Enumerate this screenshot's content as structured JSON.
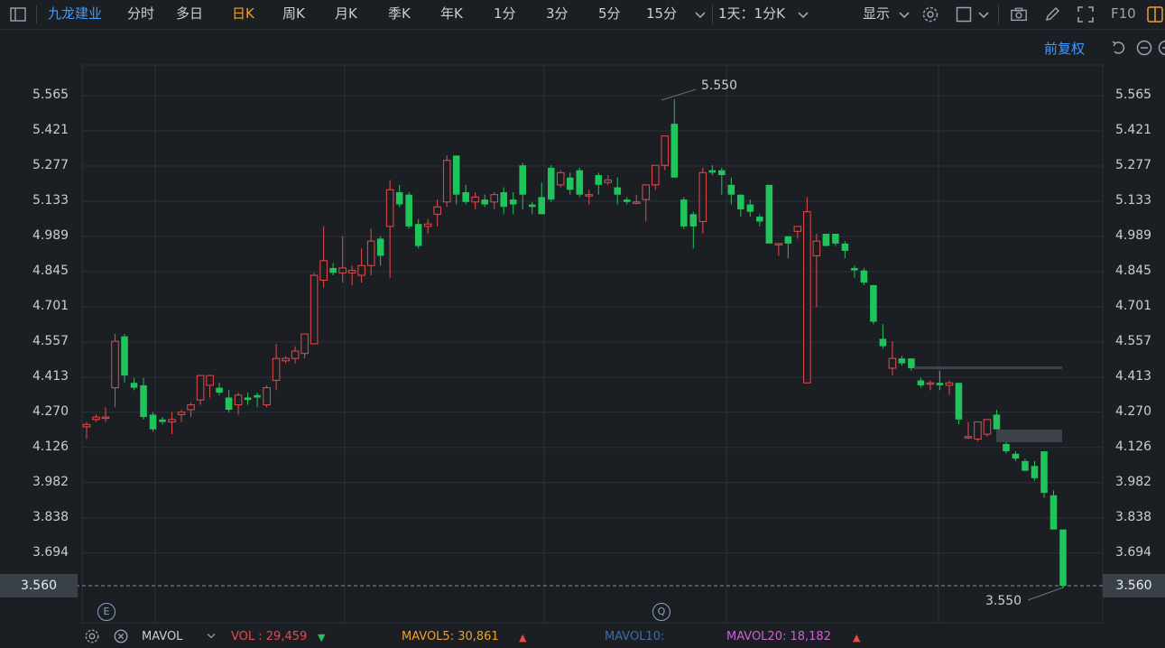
{
  "toolbar": {
    "stock_name": "九龙建业",
    "periods": [
      "分时",
      "多日",
      "日K",
      "周K",
      "月K",
      "季K",
      "年K",
      "1分",
      "3分",
      "5分",
      "15分"
    ],
    "active_period": "日K",
    "range_selector": "1天：1分K",
    "display_label": "显示",
    "f10_label": "F10"
  },
  "subbar": {
    "adjust_label": "前复权"
  },
  "chart": {
    "y_ticks": [
      "5.565",
      "5.421",
      "5.277",
      "5.133",
      "4.989",
      "4.845",
      "4.701",
      "4.557",
      "4.413",
      "4.270",
      "4.126",
      "3.982",
      "3.838",
      "3.694"
    ],
    "current_price_label": "3.560",
    "high_annotation": "5.550",
    "low_annotation": "3.550",
    "up_color": "#e84a4a",
    "down_color": "#1fc45a"
  },
  "chart_data": {
    "type": "candlestick",
    "ylim": [
      3.56,
      5.565
    ],
    "up_color": "#e84a4a",
    "down_color": "#1fc45a",
    "candles": [
      {
        "o": 4.21,
        "h": 4.23,
        "l": 4.16,
        "c": 4.22
      },
      {
        "o": 4.24,
        "h": 4.26,
        "l": 4.23,
        "c": 4.25
      },
      {
        "o": 4.25,
        "h": 4.29,
        "l": 4.23,
        "c": 4.25
      },
      {
        "o": 4.37,
        "h": 4.59,
        "l": 4.29,
        "c": 4.56
      },
      {
        "o": 4.58,
        "h": 4.59,
        "l": 4.39,
        "c": 4.42
      },
      {
        "o": 4.39,
        "h": 4.41,
        "l": 4.36,
        "c": 4.37
      },
      {
        "o": 4.38,
        "h": 4.41,
        "l": 4.24,
        "c": 4.25
      },
      {
        "o": 4.26,
        "h": 4.27,
        "l": 4.19,
        "c": 4.2
      },
      {
        "o": 4.24,
        "h": 4.25,
        "l": 4.22,
        "c": 4.23
      },
      {
        "o": 4.23,
        "h": 4.27,
        "l": 4.18,
        "c": 4.24
      },
      {
        "o": 4.26,
        "h": 4.28,
        "l": 4.23,
        "c": 4.27
      },
      {
        "o": 4.28,
        "h": 4.31,
        "l": 4.25,
        "c": 4.3
      },
      {
        "o": 4.32,
        "h": 4.42,
        "l": 4.3,
        "c": 4.42
      },
      {
        "o": 4.38,
        "h": 4.42,
        "l": 4.33,
        "c": 4.42
      },
      {
        "o": 4.37,
        "h": 4.39,
        "l": 4.34,
        "c": 4.35
      },
      {
        "o": 4.33,
        "h": 4.36,
        "l": 4.27,
        "c": 4.28
      },
      {
        "o": 4.3,
        "h": 4.35,
        "l": 4.26,
        "c": 4.34
      },
      {
        "o": 4.33,
        "h": 4.35,
        "l": 4.3,
        "c": 4.32
      },
      {
        "o": 4.34,
        "h": 4.35,
        "l": 4.29,
        "c": 4.33
      },
      {
        "o": 4.3,
        "h": 4.38,
        "l": 4.29,
        "c": 4.37
      },
      {
        "o": 4.4,
        "h": 4.55,
        "l": 4.36,
        "c": 4.49
      },
      {
        "o": 4.48,
        "h": 4.5,
        "l": 4.47,
        "c": 4.49
      },
      {
        "o": 4.49,
        "h": 4.54,
        "l": 4.47,
        "c": 4.52
      },
      {
        "o": 4.51,
        "h": 4.58,
        "l": 4.49,
        "c": 4.59
      },
      {
        "o": 4.55,
        "h": 4.84,
        "l": 4.55,
        "c": 4.83
      },
      {
        "o": 4.81,
        "h": 5.03,
        "l": 4.78,
        "c": 4.89
      },
      {
        "o": 4.86,
        "h": 4.88,
        "l": 4.83,
        "c": 4.84
      },
      {
        "o": 4.84,
        "h": 4.99,
        "l": 4.8,
        "c": 4.86
      },
      {
        "o": 4.84,
        "h": 4.87,
        "l": 4.79,
        "c": 4.85
      },
      {
        "o": 4.83,
        "h": 4.94,
        "l": 4.8,
        "c": 4.87
      },
      {
        "o": 4.87,
        "h": 5.02,
        "l": 4.83,
        "c": 4.97
      },
      {
        "o": 4.98,
        "h": 4.99,
        "l": 4.87,
        "c": 4.91
      },
      {
        "o": 5.03,
        "h": 5.22,
        "l": 4.82,
        "c": 5.18
      },
      {
        "o": 5.17,
        "h": 5.2,
        "l": 5.11,
        "c": 5.12
      },
      {
        "o": 5.16,
        "h": 5.17,
        "l": 5.02,
        "c": 5.03
      },
      {
        "o": 5.04,
        "h": 5.06,
        "l": 4.94,
        "c": 4.95
      },
      {
        "o": 5.03,
        "h": 5.06,
        "l": 5.0,
        "c": 5.04
      },
      {
        "o": 5.08,
        "h": 5.14,
        "l": 5.03,
        "c": 5.11
      },
      {
        "o": 5.13,
        "h": 5.32,
        "l": 5.11,
        "c": 5.3
      },
      {
        "o": 5.32,
        "h": 5.32,
        "l": 5.12,
        "c": 5.16
      },
      {
        "o": 5.17,
        "h": 5.2,
        "l": 5.12,
        "c": 5.13
      },
      {
        "o": 5.13,
        "h": 5.17,
        "l": 5.1,
        "c": 5.15
      },
      {
        "o": 5.14,
        "h": 5.16,
        "l": 5.11,
        "c": 5.12
      },
      {
        "o": 5.13,
        "h": 5.17,
        "l": 5.1,
        "c": 5.16
      },
      {
        "o": 5.17,
        "h": 5.19,
        "l": 5.08,
        "c": 5.11
      },
      {
        "o": 5.14,
        "h": 5.17,
        "l": 5.08,
        "c": 5.12
      },
      {
        "o": 5.28,
        "h": 5.29,
        "l": 5.1,
        "c": 5.16
      },
      {
        "o": 5.12,
        "h": 5.13,
        "l": 5.08,
        "c": 5.11
      },
      {
        "o": 5.15,
        "h": 5.21,
        "l": 5.1,
        "c": 5.08
      },
      {
        "o": 5.27,
        "h": 5.28,
        "l": 5.13,
        "c": 5.14
      },
      {
        "o": 5.2,
        "h": 5.26,
        "l": 5.19,
        "c": 5.25
      },
      {
        "o": 5.23,
        "h": 5.25,
        "l": 5.16,
        "c": 5.18
      },
      {
        "o": 5.26,
        "h": 5.27,
        "l": 5.15,
        "c": 5.16
      },
      {
        "o": 5.16,
        "h": 5.18,
        "l": 5.12,
        "c": 5.16
      },
      {
        "o": 5.24,
        "h": 5.25,
        "l": 5.16,
        "c": 5.2
      },
      {
        "o": 5.21,
        "h": 5.24,
        "l": 5.2,
        "c": 5.22
      },
      {
        "o": 5.19,
        "h": 5.23,
        "l": 5.12,
        "c": 5.16
      },
      {
        "o": 5.14,
        "h": 5.15,
        "l": 5.12,
        "c": 5.13
      },
      {
        "o": 5.13,
        "h": 5.16,
        "l": 5.12,
        "c": 5.13
      },
      {
        "o": 5.14,
        "h": 5.17,
        "l": 5.05,
        "c": 5.2
      },
      {
        "o": 5.2,
        "h": 5.28,
        "l": 5.18,
        "c": 5.28
      },
      {
        "o": 5.28,
        "h": 5.35,
        "l": 5.26,
        "c": 5.4
      },
      {
        "o": 5.45,
        "h": 5.55,
        "l": 5.23,
        "c": 5.23
      },
      {
        "o": 5.14,
        "h": 5.15,
        "l": 5.02,
        "c": 5.03
      },
      {
        "o": 5.08,
        "h": 5.09,
        "l": 4.94,
        "c": 5.03
      },
      {
        "o": 5.05,
        "h": 5.27,
        "l": 5.0,
        "c": 5.25
      },
      {
        "o": 5.26,
        "h": 5.28,
        "l": 5.24,
        "c": 5.25
      },
      {
        "o": 5.26,
        "h": 5.27,
        "l": 5.16,
        "c": 5.24
      },
      {
        "o": 5.2,
        "h": 5.23,
        "l": 5.12,
        "c": 5.16
      },
      {
        "o": 5.16,
        "h": 5.15,
        "l": 5.07,
        "c": 5.1
      },
      {
        "o": 5.12,
        "h": 5.14,
        "l": 5.07,
        "c": 5.09
      },
      {
        "o": 5.07,
        "h": 5.08,
        "l": 5.03,
        "c": 5.05
      },
      {
        "o": 5.2,
        "h": 5.2,
        "l": 4.97,
        "c": 4.96
      },
      {
        "o": 4.96,
        "h": 4.95,
        "l": 4.91,
        "c": 4.96
      },
      {
        "o": 4.99,
        "h": 4.99,
        "l": 4.9,
        "c": 4.96
      },
      {
        "o": 5.01,
        "h": 5.02,
        "l": 4.98,
        "c": 5.03
      },
      {
        "o": 4.39,
        "h": 5.15,
        "l": 4.39,
        "c": 5.09
      },
      {
        "o": 4.91,
        "h": 5.0,
        "l": 4.7,
        "c": 4.97
      },
      {
        "o": 5.0,
        "h": 5.0,
        "l": 4.95,
        "c": 4.95
      },
      {
        "o": 5.0,
        "h": 5.0,
        "l": 4.95,
        "c": 4.96
      },
      {
        "o": 4.96,
        "h": 4.97,
        "l": 4.9,
        "c": 4.93
      },
      {
        "o": 4.86,
        "h": 4.87,
        "l": 4.82,
        "c": 4.85
      },
      {
        "o": 4.85,
        "h": 4.86,
        "l": 4.79,
        "c": 4.8
      },
      {
        "o": 4.79,
        "h": 4.79,
        "l": 4.63,
        "c": 4.64
      },
      {
        "o": 4.57,
        "h": 4.63,
        "l": 4.53,
        "c": 4.54
      },
      {
        "o": 4.45,
        "h": 4.56,
        "l": 4.42,
        "c": 4.49
      },
      {
        "o": 4.49,
        "h": 4.5,
        "l": 4.46,
        "c": 4.47
      },
      {
        "o": 4.49,
        "h": 4.49,
        "l": 4.44,
        "c": 4.45
      },
      {
        "o": 4.4,
        "h": 4.41,
        "l": 4.37,
        "c": 4.38
      },
      {
        "o": 4.39,
        "h": 4.4,
        "l": 4.36,
        "c": 4.39
      },
      {
        "o": 4.39,
        "h": 4.44,
        "l": 4.36,
        "c": 4.38
      },
      {
        "o": 4.38,
        "h": 4.4,
        "l": 4.34,
        "c": 4.39
      },
      {
        "o": 4.39,
        "h": 4.39,
        "l": 4.22,
        "c": 4.24
      },
      {
        "o": 4.17,
        "h": 4.23,
        "l": 4.16,
        "c": 4.17
      },
      {
        "o": 4.16,
        "h": 4.23,
        "l": 4.15,
        "c": 4.23
      },
      {
        "o": 4.18,
        "h": 4.24,
        "l": 4.17,
        "c": 4.24
      },
      {
        "o": 4.26,
        "h": 4.28,
        "l": 4.2,
        "c": 4.2
      },
      {
        "o": 4.14,
        "h": 4.15,
        "l": 4.1,
        "c": 4.11
      },
      {
        "o": 4.1,
        "h": 4.11,
        "l": 4.07,
        "c": 4.08
      },
      {
        "o": 4.07,
        "h": 4.08,
        "l": 4.03,
        "c": 4.03
      },
      {
        "o": 4.05,
        "h": 4.07,
        "l": 3.99,
        "c": 4.0
      },
      {
        "o": 4.11,
        "h": 4.11,
        "l": 3.92,
        "c": 3.94
      },
      {
        "o": 3.93,
        "h": 3.95,
        "l": 3.79,
        "c": 3.79
      },
      {
        "o": 3.79,
        "h": 3.79,
        "l": 3.55,
        "c": 3.56
      }
    ]
  },
  "volume_bar": {
    "indicator_name": "MAVOL",
    "vol_label": "VOL : 29,459",
    "vol_arrow": "▼",
    "mavol5_label": "MAVOL5: 30,861",
    "mavol5_arrow": "▲",
    "mavol10_label": "MAVOL10:",
    "mavol20_label": "MAVOL20: 18,182",
    "mavol20_arrow": "▲"
  }
}
